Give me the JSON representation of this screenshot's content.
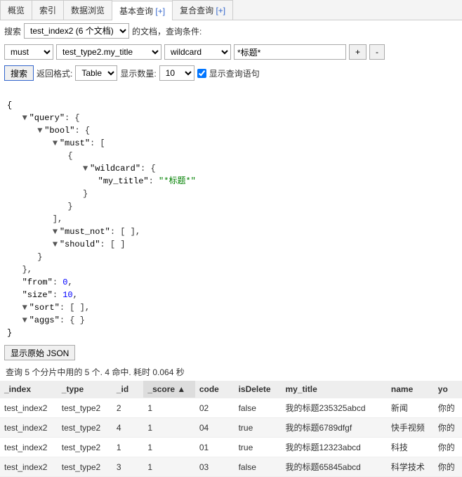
{
  "tabs": {
    "t0": "概览",
    "t1": "索引",
    "t2": "数据浏览",
    "t3": "基本查询",
    "t3_plus": "[+]",
    "t4": "复合查询",
    "t4_plus": "[+]"
  },
  "search_row": {
    "label_search": "搜索",
    "index_selected": "test_index2 (6 个文档)",
    "label_doc": "的文档，查询条件:"
  },
  "cond": {
    "bool_op": "must",
    "field": "test_type2.my_title",
    "query_type": "wildcard",
    "value": "*标题*",
    "plus": "+",
    "minus": "-"
  },
  "run": {
    "search_btn": "搜索",
    "label_format": "返回格式:",
    "format": "Table",
    "label_count": "显示数量:",
    "count": "10",
    "show_query_label": "显示查询语句"
  },
  "json": {
    "query": "\"query\"",
    "bool": "\"bool\"",
    "must": "\"must\"",
    "wildcard": "\"wildcard\"",
    "my_title": "\"my_title\"",
    "my_title_val": "\"*标题*\"",
    "must_not": "\"must_not\"",
    "should": "\"should\"",
    "from": "\"from\"",
    "from_v": "0",
    "size": "\"size\"",
    "size_v": "10",
    "sort": "\"sort\"",
    "aggs": "\"aggs\""
  },
  "raw_btn": "显示原始 JSON",
  "stats": "查询 5 个分片中用的 5 个. 4 命中. 耗时 0.064 秒",
  "headers": {
    "index": "_index",
    "type": "_type",
    "id": "_id",
    "score": "_score ▲",
    "code": "code",
    "isDelete": "isDelete",
    "my_title": "my_title",
    "name": "name",
    "yourname": "yo"
  },
  "rows": [
    {
      "index": "test_index2",
      "type": "test_type2",
      "id": "2",
      "score": "1",
      "code": "02",
      "isDelete": "false",
      "my_title": "我的标题235325abcd",
      "name": "新闻",
      "yourname": "你的"
    },
    {
      "index": "test_index2",
      "type": "test_type2",
      "id": "4",
      "score": "1",
      "code": "04",
      "isDelete": "true",
      "my_title": "我的标题6789dfgf",
      "name": "快手视频",
      "yourname": "你的"
    },
    {
      "index": "test_index2",
      "type": "test_type2",
      "id": "1",
      "score": "1",
      "code": "01",
      "isDelete": "true",
      "my_title": "我的标题12323abcd",
      "name": "科技",
      "yourname": "你的"
    },
    {
      "index": "test_index2",
      "type": "test_type2",
      "id": "3",
      "score": "1",
      "code": "03",
      "isDelete": "false",
      "my_title": "我的标题65845abcd",
      "name": "科学技术",
      "yourname": "你的"
    }
  ]
}
